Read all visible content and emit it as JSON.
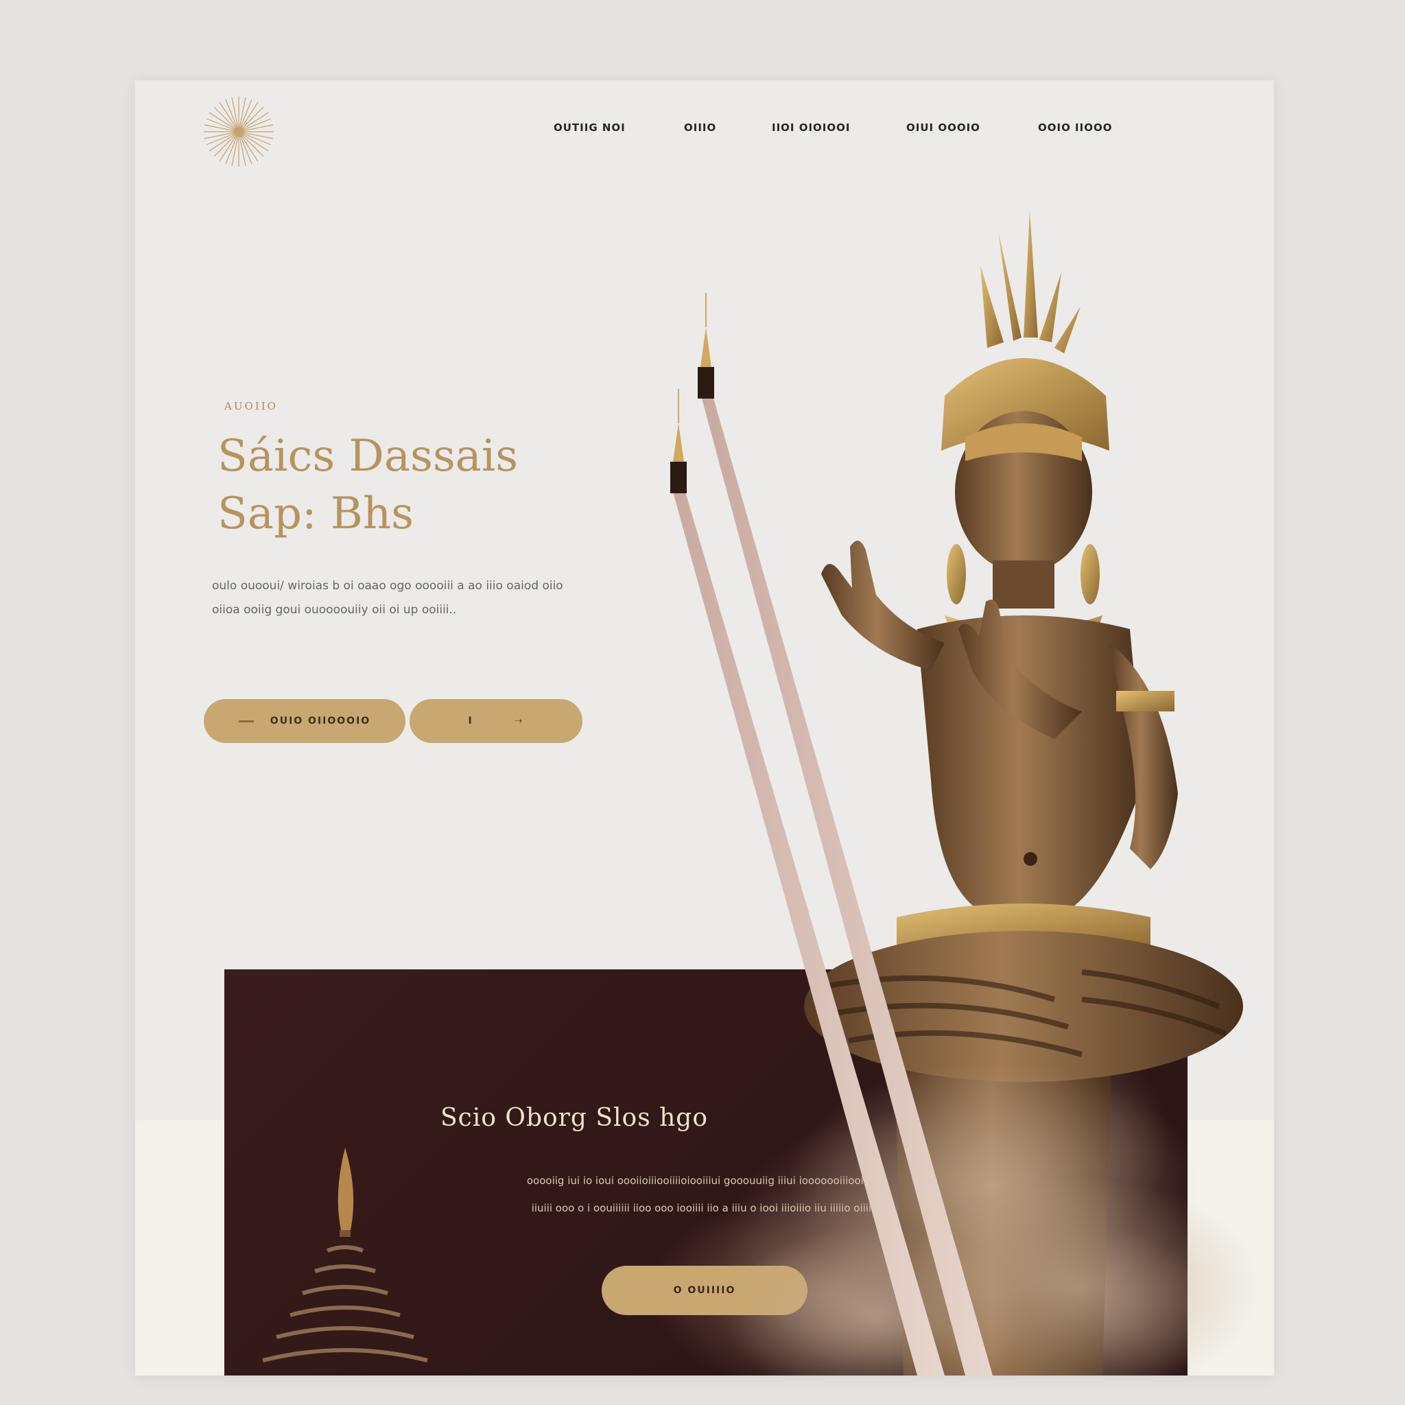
{
  "nav": {
    "items": [
      {
        "label": "OUTIIG NOI"
      },
      {
        "label": "OIIIO"
      },
      {
        "label": "IIOI OIOIOOI"
      },
      {
        "label": "OIUI OOOIO"
      },
      {
        "label": "OOIO IIOOO"
      }
    ]
  },
  "hero": {
    "eyebrow": "AUOIIO",
    "title_line1": "Sáics Dassais",
    "title_line2": "Sap: Bhs",
    "desc_line1": "oulo ouooui/ wiroias b oi oaao ogo ooooiii a ao iiio oaiod oiio",
    "desc_line2": "oiioa ooiig goui ouoooouiiy oii oi up ooiiii..",
    "primary_button": "OUIO OIIOOOIO",
    "secondary_button": "I"
  },
  "panel": {
    "title": "Scio  Oborg  Slos  hgo",
    "desc_line1": "ooooiig iui io ioui oooiioiiiooiiiioiooiiiui gooouuiig iiiui iooooooiiiooiio o",
    "desc_line2": "iiuiii ooo o i oouiiiiii iioo ooo iooiiii iio a iiiu o iooi iiioiiio iiu iiiiio oiiiio",
    "button": "O OUIIIIO"
  },
  "colors": {
    "accent_gold": "#c9a770",
    "title_gold": "#b8935e",
    "dark_panel": "#321818",
    "page_bg": "#ecebe9"
  }
}
